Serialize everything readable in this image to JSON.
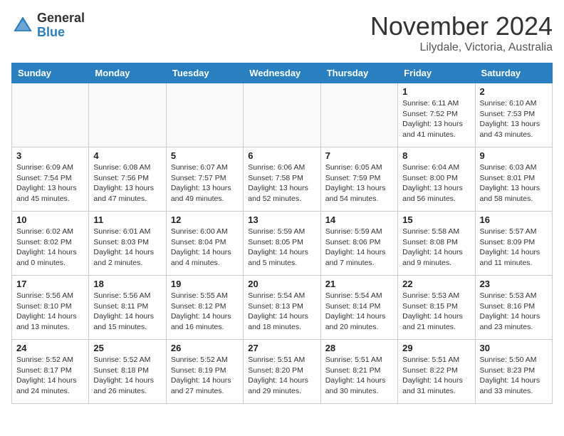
{
  "header": {
    "logo_line1": "General",
    "logo_line2": "Blue",
    "month": "November 2024",
    "location": "Lilydale, Victoria, Australia"
  },
  "weekdays": [
    "Sunday",
    "Monday",
    "Tuesday",
    "Wednesday",
    "Thursday",
    "Friday",
    "Saturday"
  ],
  "weeks": [
    [
      {
        "day": "",
        "info": ""
      },
      {
        "day": "",
        "info": ""
      },
      {
        "day": "",
        "info": ""
      },
      {
        "day": "",
        "info": ""
      },
      {
        "day": "",
        "info": ""
      },
      {
        "day": "1",
        "info": "Sunrise: 6:11 AM\nSunset: 7:52 PM\nDaylight: 13 hours\nand 41 minutes."
      },
      {
        "day": "2",
        "info": "Sunrise: 6:10 AM\nSunset: 7:53 PM\nDaylight: 13 hours\nand 43 minutes."
      }
    ],
    [
      {
        "day": "3",
        "info": "Sunrise: 6:09 AM\nSunset: 7:54 PM\nDaylight: 13 hours\nand 45 minutes."
      },
      {
        "day": "4",
        "info": "Sunrise: 6:08 AM\nSunset: 7:56 PM\nDaylight: 13 hours\nand 47 minutes."
      },
      {
        "day": "5",
        "info": "Sunrise: 6:07 AM\nSunset: 7:57 PM\nDaylight: 13 hours\nand 49 minutes."
      },
      {
        "day": "6",
        "info": "Sunrise: 6:06 AM\nSunset: 7:58 PM\nDaylight: 13 hours\nand 52 minutes."
      },
      {
        "day": "7",
        "info": "Sunrise: 6:05 AM\nSunset: 7:59 PM\nDaylight: 13 hours\nand 54 minutes."
      },
      {
        "day": "8",
        "info": "Sunrise: 6:04 AM\nSunset: 8:00 PM\nDaylight: 13 hours\nand 56 minutes."
      },
      {
        "day": "9",
        "info": "Sunrise: 6:03 AM\nSunset: 8:01 PM\nDaylight: 13 hours\nand 58 minutes."
      }
    ],
    [
      {
        "day": "10",
        "info": "Sunrise: 6:02 AM\nSunset: 8:02 PM\nDaylight: 14 hours\nand 0 minutes."
      },
      {
        "day": "11",
        "info": "Sunrise: 6:01 AM\nSunset: 8:03 PM\nDaylight: 14 hours\nand 2 minutes."
      },
      {
        "day": "12",
        "info": "Sunrise: 6:00 AM\nSunset: 8:04 PM\nDaylight: 14 hours\nand 4 minutes."
      },
      {
        "day": "13",
        "info": "Sunrise: 5:59 AM\nSunset: 8:05 PM\nDaylight: 14 hours\nand 5 minutes."
      },
      {
        "day": "14",
        "info": "Sunrise: 5:59 AM\nSunset: 8:06 PM\nDaylight: 14 hours\nand 7 minutes."
      },
      {
        "day": "15",
        "info": "Sunrise: 5:58 AM\nSunset: 8:08 PM\nDaylight: 14 hours\nand 9 minutes."
      },
      {
        "day": "16",
        "info": "Sunrise: 5:57 AM\nSunset: 8:09 PM\nDaylight: 14 hours\nand 11 minutes."
      }
    ],
    [
      {
        "day": "17",
        "info": "Sunrise: 5:56 AM\nSunset: 8:10 PM\nDaylight: 14 hours\nand 13 minutes."
      },
      {
        "day": "18",
        "info": "Sunrise: 5:56 AM\nSunset: 8:11 PM\nDaylight: 14 hours\nand 15 minutes."
      },
      {
        "day": "19",
        "info": "Sunrise: 5:55 AM\nSunset: 8:12 PM\nDaylight: 14 hours\nand 16 minutes."
      },
      {
        "day": "20",
        "info": "Sunrise: 5:54 AM\nSunset: 8:13 PM\nDaylight: 14 hours\nand 18 minutes."
      },
      {
        "day": "21",
        "info": "Sunrise: 5:54 AM\nSunset: 8:14 PM\nDaylight: 14 hours\nand 20 minutes."
      },
      {
        "day": "22",
        "info": "Sunrise: 5:53 AM\nSunset: 8:15 PM\nDaylight: 14 hours\nand 21 minutes."
      },
      {
        "day": "23",
        "info": "Sunrise: 5:53 AM\nSunset: 8:16 PM\nDaylight: 14 hours\nand 23 minutes."
      }
    ],
    [
      {
        "day": "24",
        "info": "Sunrise: 5:52 AM\nSunset: 8:17 PM\nDaylight: 14 hours\nand 24 minutes."
      },
      {
        "day": "25",
        "info": "Sunrise: 5:52 AM\nSunset: 8:18 PM\nDaylight: 14 hours\nand 26 minutes."
      },
      {
        "day": "26",
        "info": "Sunrise: 5:52 AM\nSunset: 8:19 PM\nDaylight: 14 hours\nand 27 minutes."
      },
      {
        "day": "27",
        "info": "Sunrise: 5:51 AM\nSunset: 8:20 PM\nDaylight: 14 hours\nand 29 minutes."
      },
      {
        "day": "28",
        "info": "Sunrise: 5:51 AM\nSunset: 8:21 PM\nDaylight: 14 hours\nand 30 minutes."
      },
      {
        "day": "29",
        "info": "Sunrise: 5:51 AM\nSunset: 8:22 PM\nDaylight: 14 hours\nand 31 minutes."
      },
      {
        "day": "30",
        "info": "Sunrise: 5:50 AM\nSunset: 8:23 PM\nDaylight: 14 hours\nand 33 minutes."
      }
    ]
  ]
}
